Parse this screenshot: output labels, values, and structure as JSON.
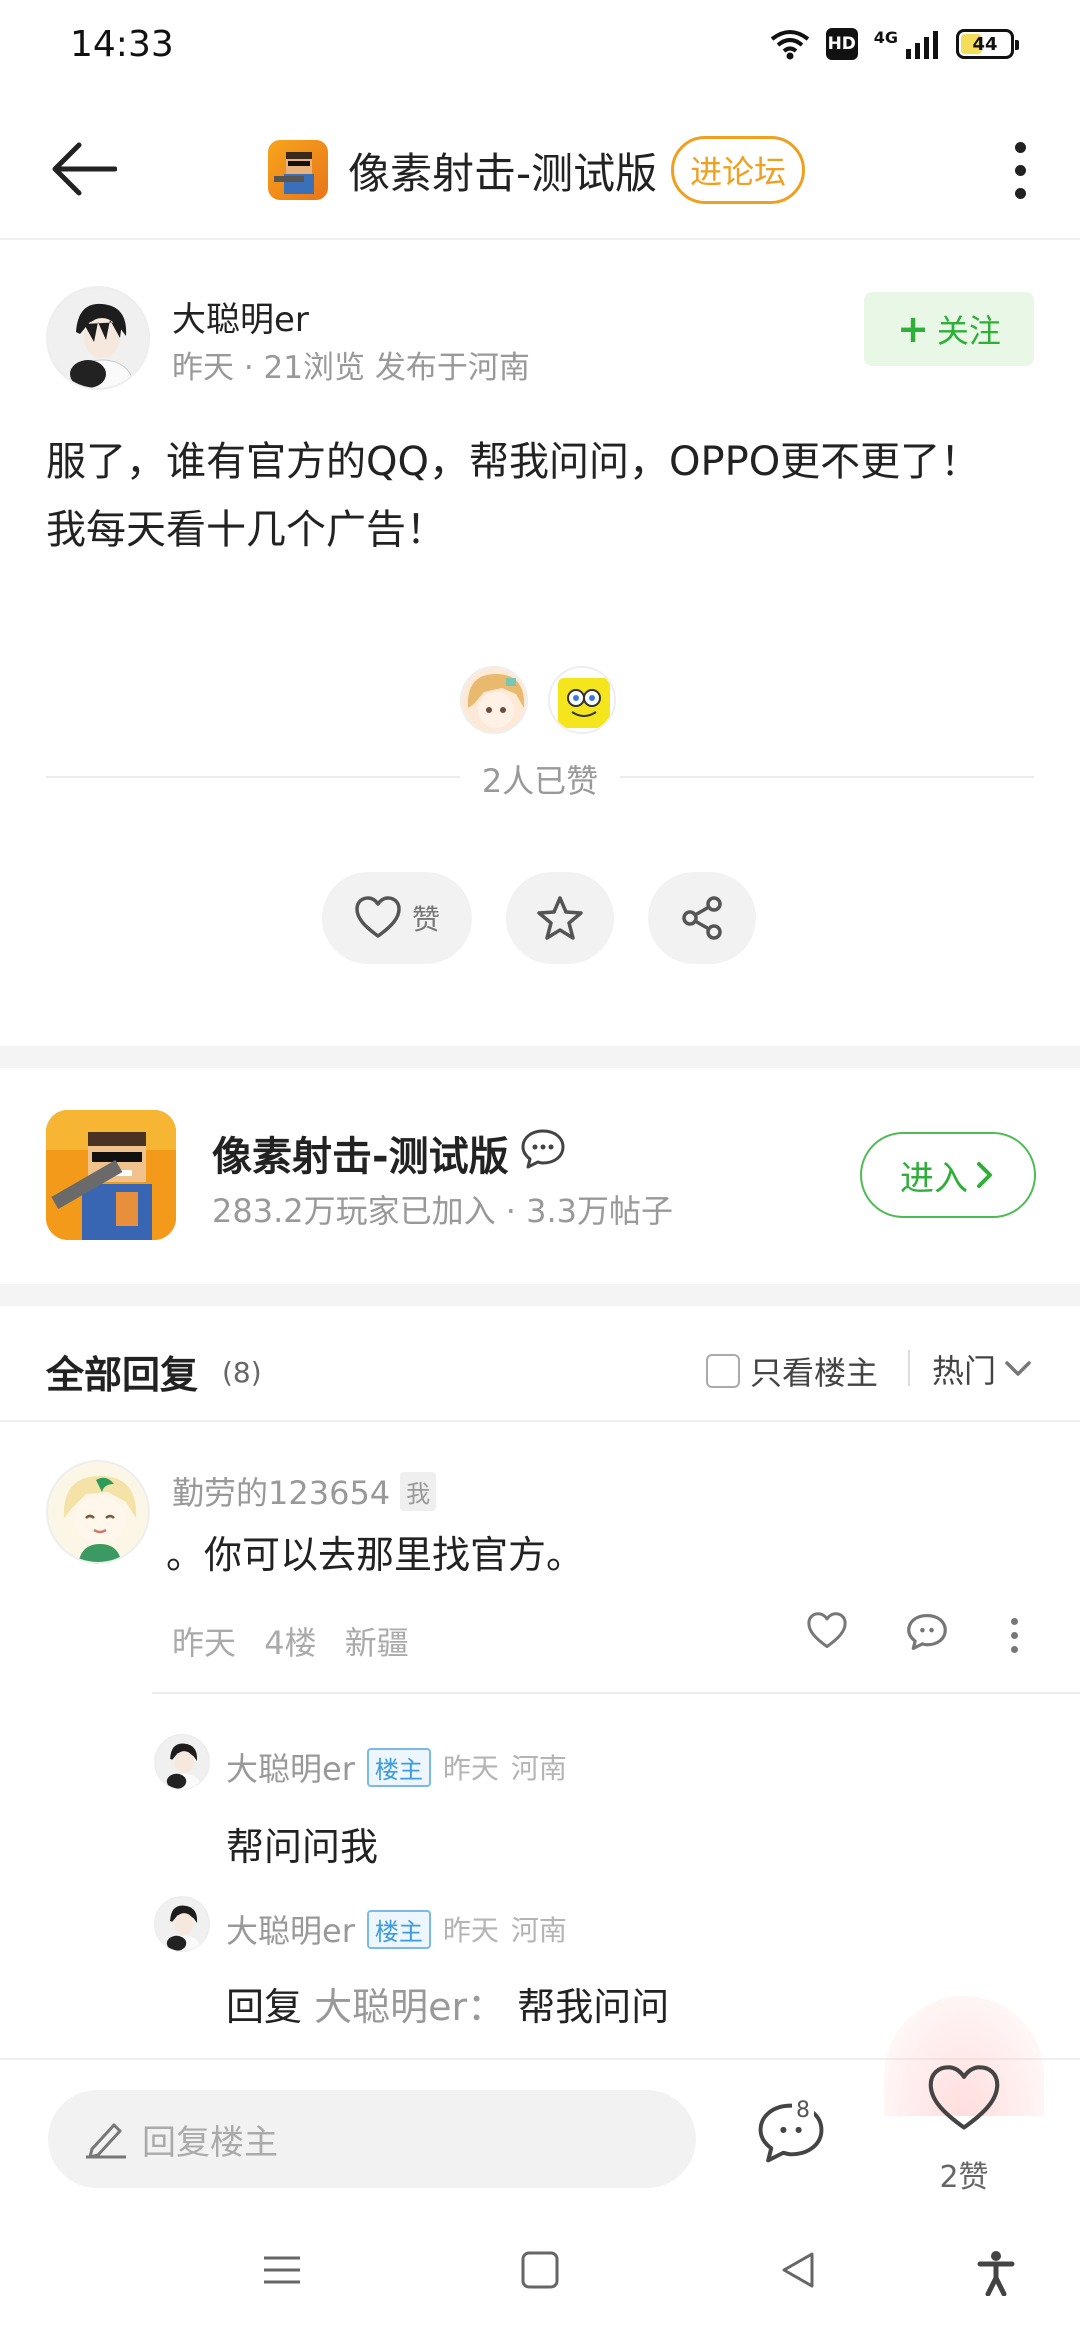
{
  "status_bar": {
    "time": "14:33",
    "network": "4G",
    "hd": "HD",
    "battery_level": "44",
    "battery_fraction": 0.44
  },
  "header": {
    "title": "像素射击-测试版",
    "enter_forum_label": "进论坛"
  },
  "post": {
    "author": "大聪明er",
    "meta": "昨天 · 21浏览  发布于河南",
    "follow_label": "关注",
    "body_line1": "服了，谁有官方的QQ，帮我问问，OPPO更不更了！",
    "body_line2": "我每天看十几个广告！",
    "likes_summary": "2人已赞",
    "like_action_label": "赞"
  },
  "forum_card": {
    "name": "像素射击-测试版",
    "stats": "283.2万玩家已加入 · 3.3万帖子",
    "enter_label": "进入"
  },
  "replies": {
    "title": "全部回复",
    "count": "(8)",
    "op_only_label": "只看楼主",
    "sort_label": "热门",
    "items": [
      {
        "user": "勤劳的123654",
        "me_badge": "我",
        "text": "。你可以去那里找官方。",
        "time": "昨天",
        "floor": "4楼",
        "location": "新疆",
        "sub_replies": [
          {
            "user": "大聪明er",
            "badge": "楼主",
            "time": "昨天",
            "location": "河南",
            "text": "帮问问我"
          },
          {
            "user": "大聪明er",
            "badge": "楼主",
            "time": "昨天",
            "location": "河南",
            "reply_prefix": "回复",
            "reply_to": "大聪明er",
            "reply_sep": "：",
            "text": "帮我问问"
          }
        ]
      }
    ]
  },
  "bottom_bar": {
    "reply_placeholder": "回复楼主",
    "comment_count": "8",
    "like_count": "2赞"
  },
  "colors": {
    "accent_green": "#2fae3a",
    "accent_orange": "#f0a020",
    "op_badge_blue": "#3d9be0"
  }
}
